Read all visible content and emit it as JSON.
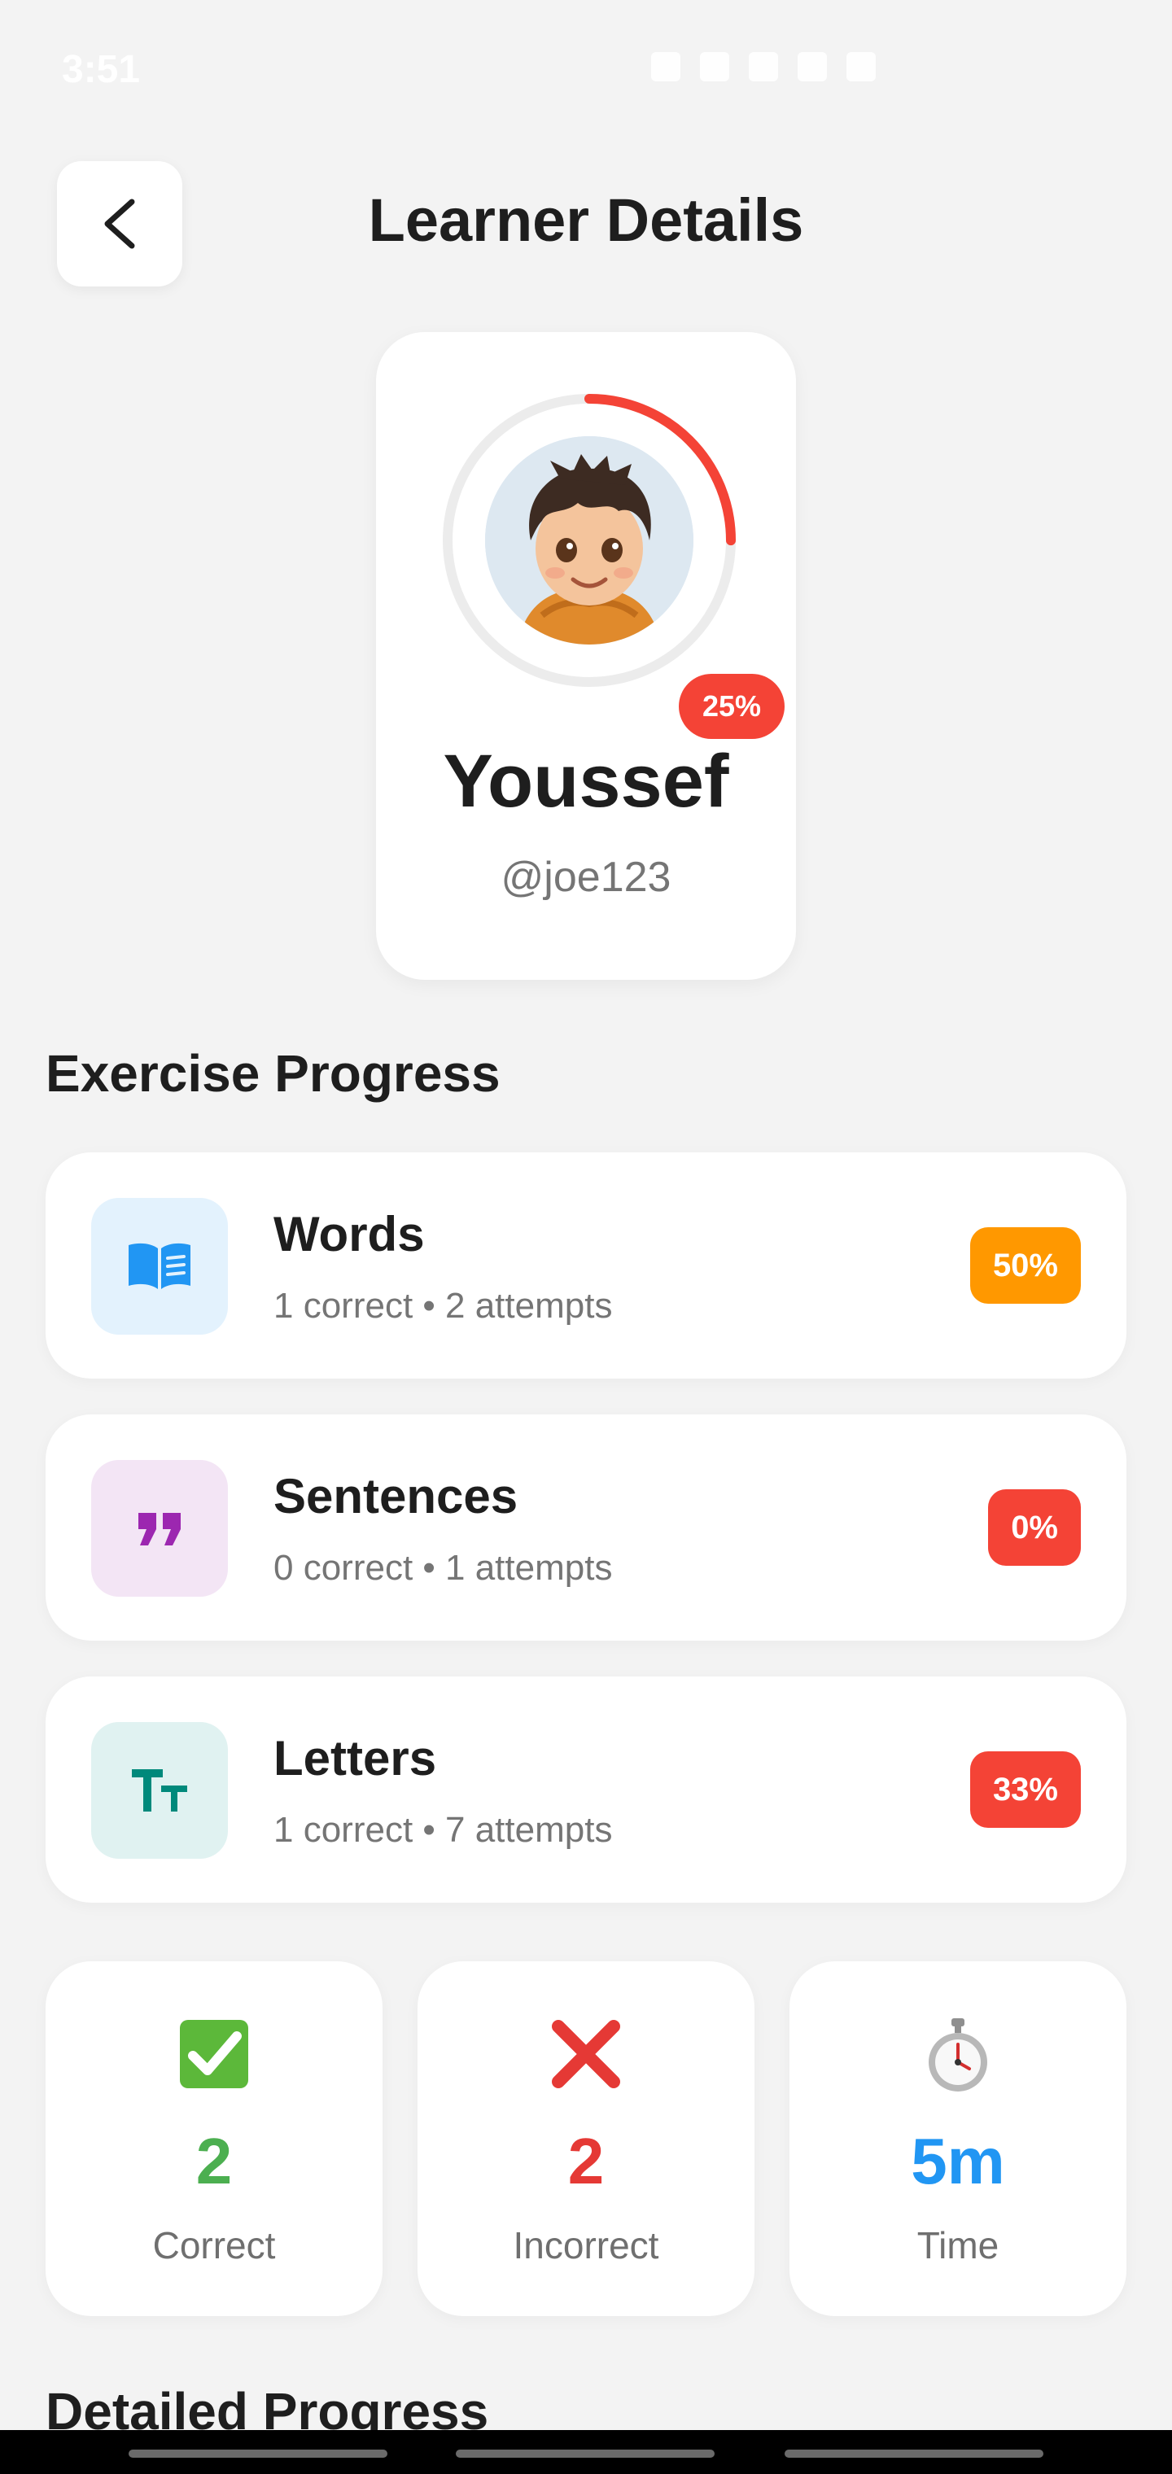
{
  "status_bar": {
    "time": "3:51"
  },
  "header": {
    "title": "Learner Details"
  },
  "profile": {
    "name": "Youssef",
    "handle": "@joe123",
    "progress_label": "25%",
    "progress_fraction": 0.25,
    "ring_color": "#f44336"
  },
  "exercise_section": {
    "title": "Exercise Progress",
    "items": [
      {
        "name": "Words",
        "stats": "1 correct • 2 attempts",
        "percent": "50%",
        "icon": "book-icon",
        "badge_color": "#ff9800",
        "icon_bg": "#e3f2fd",
        "icon_color": "#2196f3"
      },
      {
        "name": "Sentences",
        "stats": "0 correct • 1 attempts",
        "percent": "0%",
        "icon": "quote-icon",
        "badge_color": "#f44336",
        "icon_bg": "#f3e5f5",
        "icon_color": "#9c27b0"
      },
      {
        "name": "Letters",
        "stats": "1 correct • 7 attempts",
        "percent": "33%",
        "icon": "text-size-icon",
        "badge_color": "#f44336",
        "icon_bg": "#e0f2f1",
        "icon_color": "#00897b"
      }
    ]
  },
  "summary": {
    "correct": {
      "value": "2",
      "label": "Correct",
      "icon": "check-icon",
      "color": "#4caf50"
    },
    "incorrect": {
      "value": "2",
      "label": "Incorrect",
      "icon": "cross-icon",
      "color": "#e53935"
    },
    "time": {
      "value": "5m",
      "label": "Time",
      "icon": "stopwatch-icon",
      "color": "#2196f3"
    }
  },
  "detailed_section": {
    "title": "Detailed Progress"
  }
}
